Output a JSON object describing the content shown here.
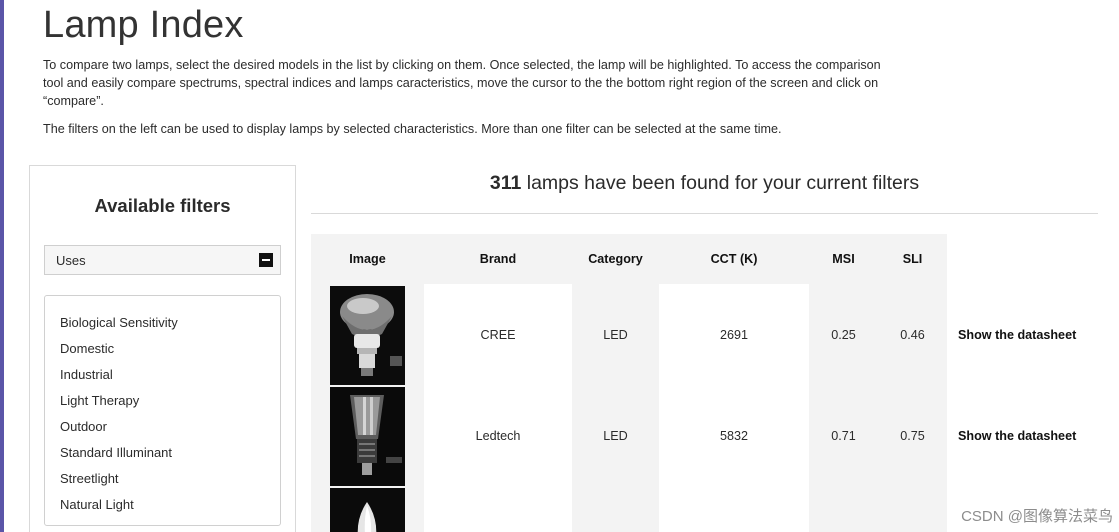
{
  "page": {
    "title": "Lamp Index",
    "intro_1": "To compare two lamps, select the desired models in the list by clicking on them. Once selected, the lamp will be highlighted. To access the comparison tool and easily compare spectrums, spectral indices and lamps caracteristics, move the cursor to the the bottom right region of the screen and click on “compare”.",
    "intro_2": "The filters on the left can be used to display lamps by selected characteristics. More than one filter can be selected at the same time."
  },
  "filters": {
    "title": "Available filters",
    "group_label": "Uses",
    "items": [
      "Biological Sensitivity",
      "Domestic",
      "Industrial",
      "Light Therapy",
      "Outdoor",
      "Standard Illuminant",
      "Streetlight",
      "Natural Light"
    ]
  },
  "results": {
    "count": "311",
    "suffix": " lamps have been found for your current filters"
  },
  "table": {
    "headers": {
      "image": "Image",
      "brand": "Brand",
      "category": "Category",
      "cct": "CCT (K)",
      "msi": "MSI",
      "sli": "SLI"
    },
    "rows": [
      {
        "brand": "CREE",
        "category": "LED",
        "cct": "2691",
        "msi": "0.25",
        "sli": "0.46",
        "link": "Show the datasheet"
      },
      {
        "brand": "Ledtech",
        "category": "LED",
        "cct": "5832",
        "msi": "0.71",
        "sli": "0.75",
        "link": "Show the datasheet"
      }
    ]
  },
  "watermark": "CSDN @图像算法菜鸟"
}
